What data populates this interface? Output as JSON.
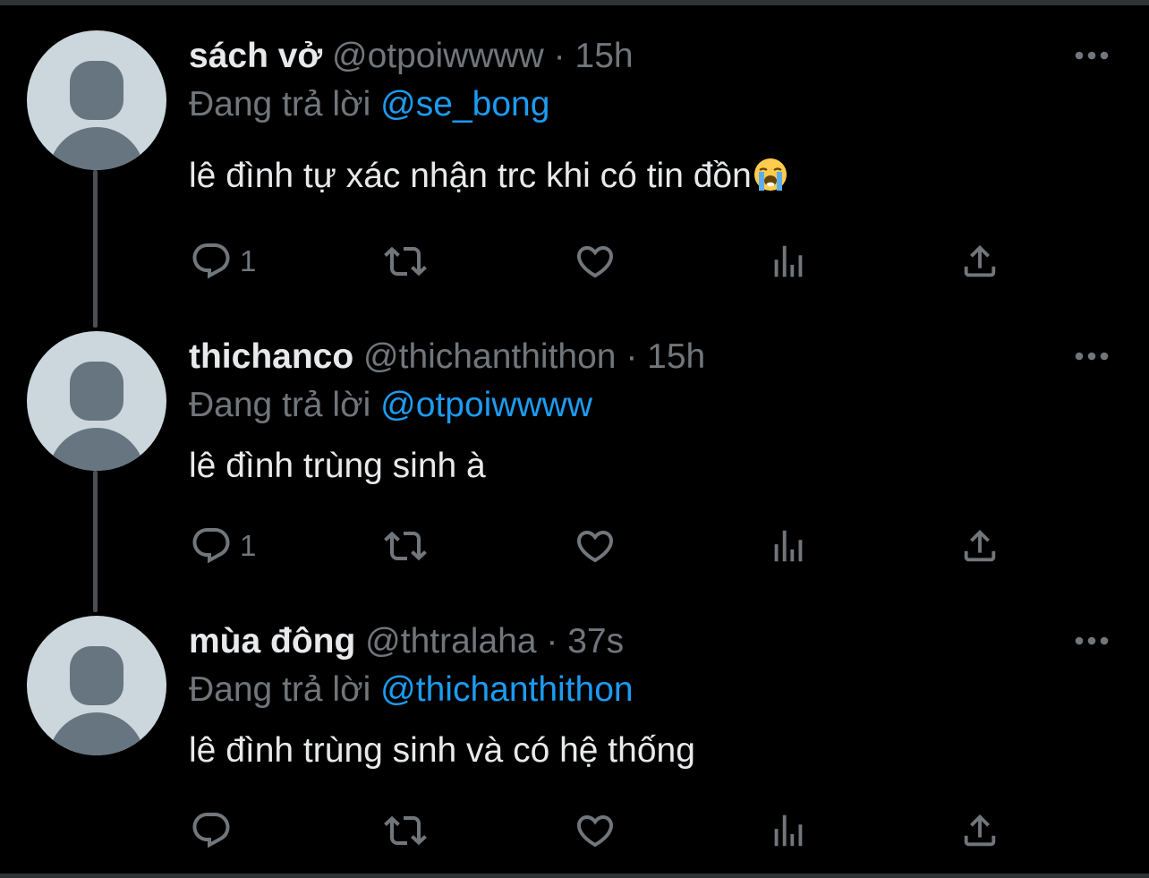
{
  "colors": {
    "background": "#000000",
    "primary_text": "#e7e9ea",
    "secondary_text": "#71767b",
    "accent": "#1d9bf0",
    "avatar_bg": "#ccd6dd",
    "avatar_fg": "#66757f"
  },
  "reply_prefix": "Đang trả lời",
  "separator": "·",
  "tweets": [
    {
      "name": "sách vở",
      "handle": "@otpoiwwww",
      "time": "15h",
      "reply_to": "@se_bong",
      "text": "lê đình tự xác nhận trc khi có tin đồn",
      "emoji": "loudly-crying-face",
      "reply_count": "1"
    },
    {
      "name": "thichanco",
      "handle": "@thichanthithon",
      "time": "15h",
      "reply_to": "@otpoiwwww",
      "text": "lê đình trùng sinh à",
      "reply_count": "1"
    },
    {
      "name": "mùa đông",
      "handle": "@thtralaha",
      "time": "37s",
      "reply_to": "@thichanthithon",
      "text": "lê đình trùng sinh và có hệ thống",
      "reply_count": ""
    }
  ]
}
